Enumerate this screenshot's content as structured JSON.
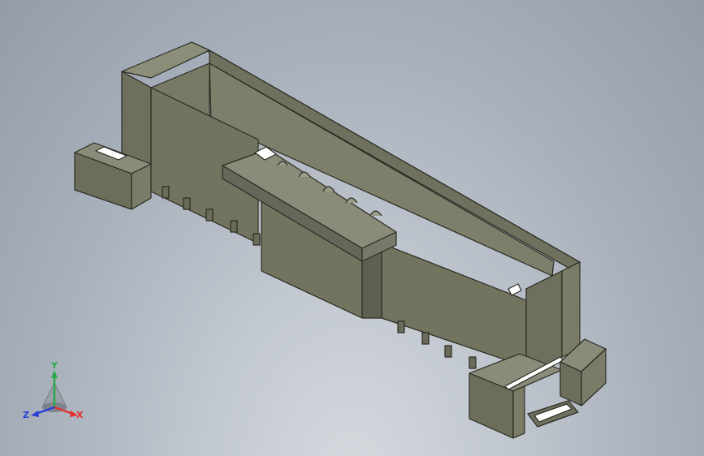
{
  "viewport": {
    "model": "connector-housing"
  },
  "colors": {
    "background_top": "#949ca8",
    "background_bottom": "#d6d9de",
    "body_top": "#8a8c79",
    "body_front": "#6e705d",
    "body_side": "#787a66",
    "edge": "#2a2b22",
    "highlight": "#ffffff"
  },
  "triad": {
    "x_label": "X",
    "y_label": "Y",
    "z_label": "Z",
    "x_color": "#e03030",
    "y_color": "#2aa84a",
    "z_color": "#2a3fd6"
  }
}
